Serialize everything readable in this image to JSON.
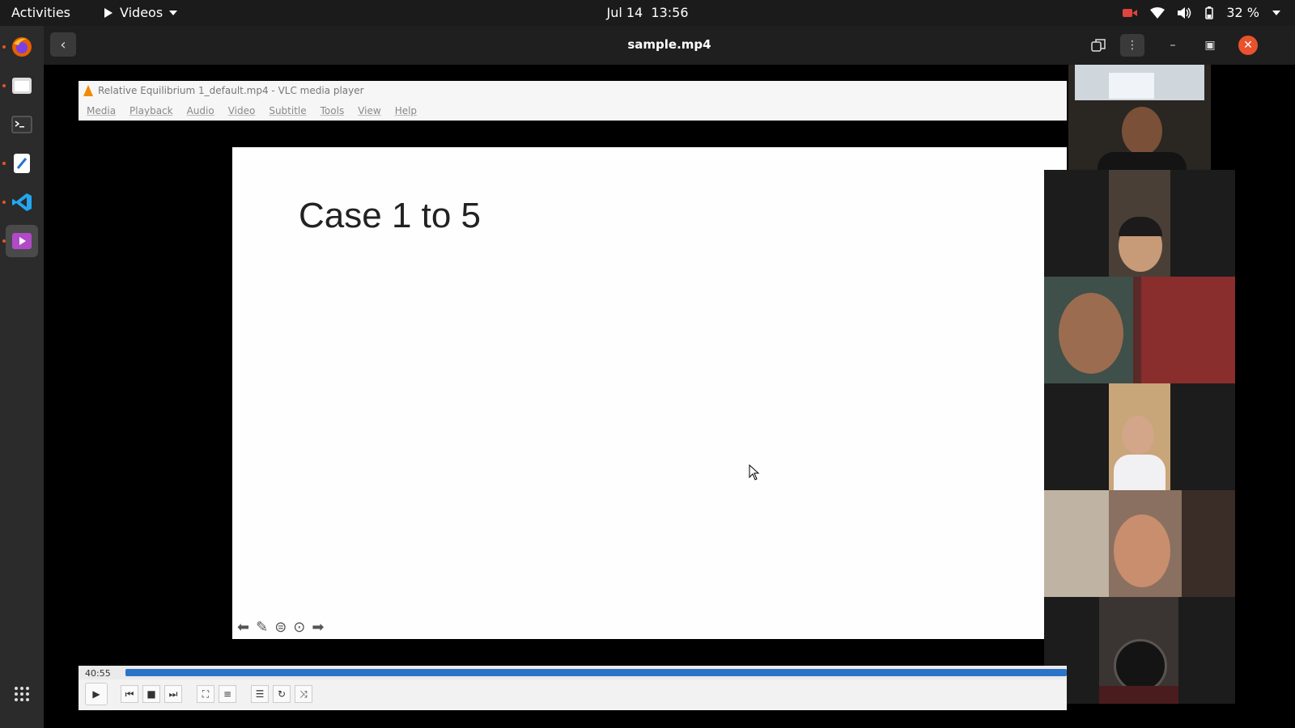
{
  "topbar": {
    "activities": "Activities",
    "app_name": "Videos",
    "date": "Jul 14",
    "time": "13:56",
    "battery": "32 %"
  },
  "dock": {
    "items": [
      "firefox-icon",
      "files-icon",
      "terminal-icon",
      "text-editor-icon",
      "vscode-icon",
      "videos-icon"
    ],
    "grid_icon": "show-apps-icon"
  },
  "header": {
    "title": "sample.mp4"
  },
  "vlc": {
    "window_title": "Relative Equilibrium 1_default.mp4 - VLC media player",
    "menu": [
      "Media",
      "Playback",
      "Audio",
      "Video",
      "Subtitle",
      "Tools",
      "View",
      "Help"
    ],
    "time": "40:55",
    "progress": 1.0
  },
  "slide": {
    "title": "Case 1 to 5"
  },
  "colors": {
    "accent": "#e95420",
    "seek": "#2b73c9",
    "close": "#e9522c"
  }
}
